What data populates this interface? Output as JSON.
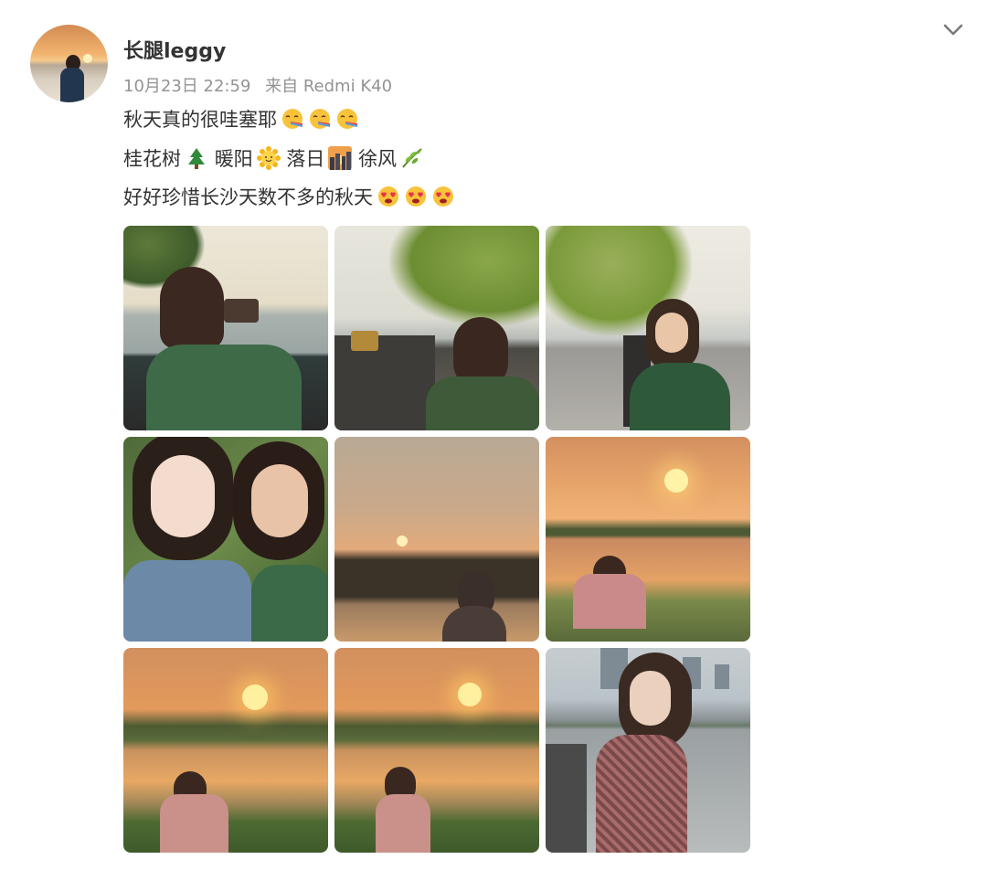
{
  "post": {
    "username": "长腿leggy",
    "timestamp": "10月23日 22:59",
    "source": "来自 Redmi K40",
    "avatar_icon": "avatar-photo",
    "menu_icon": "chevron-down-icon",
    "lines": [
      {
        "text": "秋天真的很哇塞耶",
        "emojis": [
          "rainbow-vomit-emoji",
          "rainbow-vomit-emoji",
          "rainbow-vomit-emoji"
        ]
      },
      {
        "segments": [
          {
            "text": "桂花树",
            "emoji": "tree-emoji"
          },
          {
            "text": "暖阳",
            "emoji": "sun-emoji"
          },
          {
            "text": "落日",
            "emoji": "sunset-city-emoji"
          },
          {
            "text": "徐风",
            "emoji": "leaf-emoji"
          }
        ]
      },
      {
        "text": "好好珍惜长沙天数不多的秋天",
        "emojis": [
          "heart-eyes-emoji",
          "heart-eyes-emoji",
          "heart-eyes-emoji"
        ]
      }
    ],
    "photos": [
      {
        "subject": "woman-photographing-river",
        "palette": [
          "#e7e2d4",
          "#9fa9a6",
          "#3f6a4a",
          "#3d2a22"
        ]
      },
      {
        "subject": "woman-leaning-under-tree",
        "palette": [
          "#dde0d6",
          "#7c9a48",
          "#5a564e",
          "#3d4e33"
        ]
      },
      {
        "subject": "woman-on-riverside-walkway",
        "palette": [
          "#e8e6dc",
          "#8fa65a",
          "#a4a09a",
          "#2e5a3b"
        ]
      },
      {
        "subject": "two-women-selfie",
        "palette": [
          "#4f6a3a",
          "#f0d7c8",
          "#6c8aa8",
          "#2b1f1a"
        ]
      },
      {
        "subject": "silhouette-at-sunset",
        "palette": [
          "#c9a98a",
          "#e6ad76",
          "#3b3328",
          "#4a3f38"
        ]
      },
      {
        "subject": "woman-by-sunset-river",
        "palette": [
          "#e8a66a",
          "#f6c067",
          "#5a6a3a",
          "#c88a8a"
        ]
      },
      {
        "subject": "sunset-over-water-1",
        "palette": [
          "#e39a5c",
          "#fbd36a",
          "#4d5b33",
          "#c9918a"
        ]
      },
      {
        "subject": "sunset-over-water-2",
        "palette": [
          "#e39a5c",
          "#fbd36a",
          "#4d5b33",
          "#c9918a"
        ]
      },
      {
        "subject": "woman-with-city-skyline",
        "palette": [
          "#b9c3c9",
          "#8b9296",
          "#6c4a4a",
          "#3a2f2e"
        ]
      }
    ]
  }
}
